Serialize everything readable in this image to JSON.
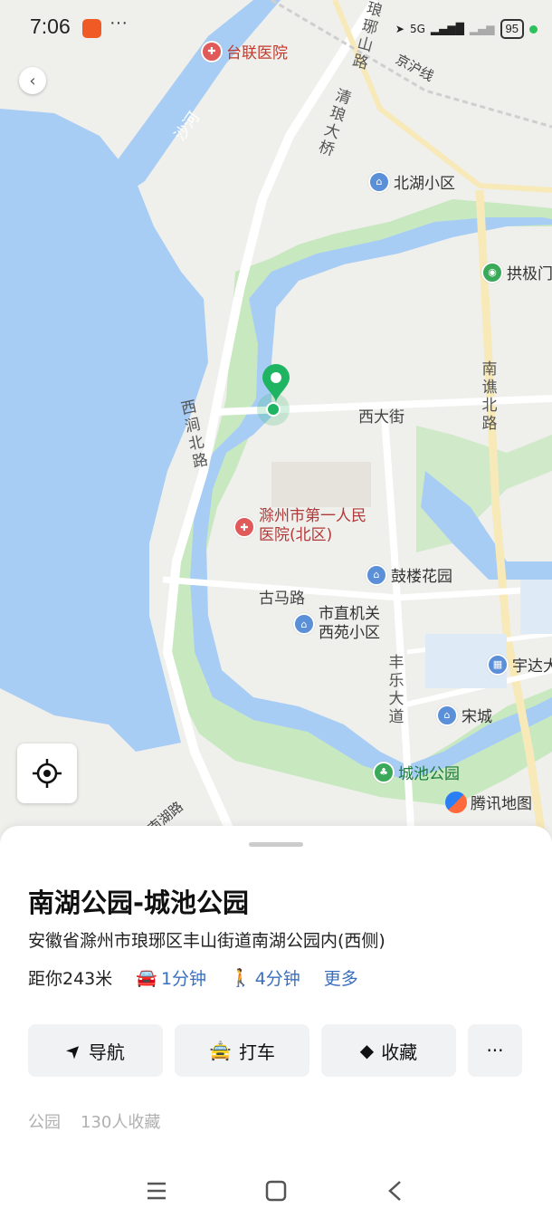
{
  "status_bar": {
    "time": "7:06",
    "network": "5G",
    "battery": "95"
  },
  "map": {
    "labels": {
      "hospital_tailian": "台联医院",
      "shahe": "沙河",
      "jinghu_line": "京沪线",
      "north_lake": "北湖小区",
      "gongji": "拱极门",
      "xida_street": "西大街",
      "gumalu": "古马路",
      "hospital_first": "滁州市第一人民医院(北区)",
      "gulou": "鼓楼花园",
      "shizhi": "市直机关西苑小区",
      "yuda": "宇达大",
      "songcheng": "宋城",
      "chengchi": "城池公园",
      "nanhu_road": "南湖路"
    },
    "vertical_roads": {
      "qingliu_bridge": "清琅大桥",
      "xijian_north": "西涧北路",
      "nanqiao_north": "南谯北路",
      "fengle_avenue": "丰乐大道",
      "langya_road": "琅琊山路"
    },
    "brand": "腾讯地图"
  },
  "place": {
    "title": "南湖公园-城池公园",
    "address": "安徽省滁州市琅琊区丰山街道南湖公园内(西侧)",
    "distance": "距你243米",
    "drive_time": "1分钟",
    "walk_time": "4分钟",
    "more_label": "更多",
    "category": "公园",
    "favorites": "130人收藏"
  },
  "actions": {
    "navigate": "导航",
    "taxi": "打车",
    "favorite": "收藏",
    "more": "···"
  },
  "colors": {
    "water": "#a8cdf5",
    "park": "#c8e8c0",
    "accent": "#3a6fbf",
    "marker": "#1fb461"
  }
}
